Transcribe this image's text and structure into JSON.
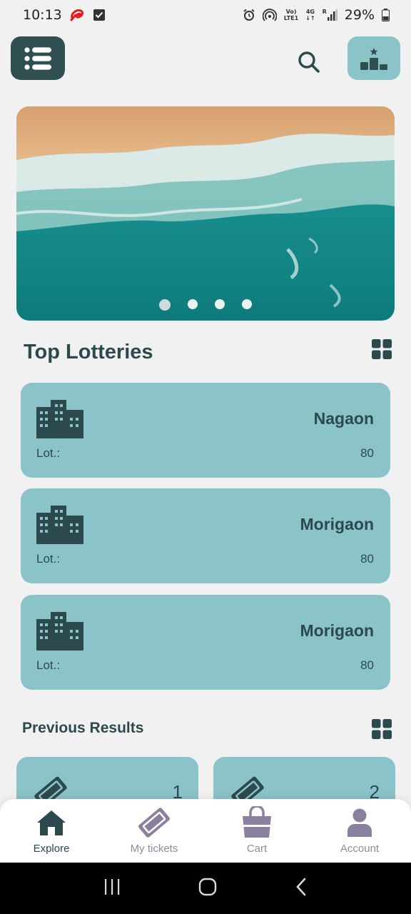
{
  "status_bar": {
    "time": "10:13",
    "battery": "29%",
    "volte_top": "Vo)",
    "volte_bottom": "LTE1",
    "net_top": "4G",
    "net_bottom": "↓↑",
    "signal_label": "R"
  },
  "toolbar": {
    "menu_icon": "list-icon",
    "search_icon": "search-icon",
    "leaderboard_icon": "podium-icon"
  },
  "banner": {
    "slide_count": 4,
    "active_slide": 1
  },
  "top_lotteries": {
    "title": "Top Lotteries",
    "items": [
      {
        "name": "Nagaon",
        "lot_label": "Lot.:",
        "lot_value": "80"
      },
      {
        "name": "Morigaon",
        "lot_label": "Lot.:",
        "lot_value": "80"
      },
      {
        "name": "Morigaon",
        "lot_label": "Lot.:",
        "lot_value": "80"
      }
    ]
  },
  "previous_results": {
    "title": "Previous Results",
    "items": [
      {
        "number": "1"
      },
      {
        "number": "2"
      }
    ]
  },
  "bottom_nav": {
    "items": [
      {
        "label": "Explore",
        "icon": "home-icon",
        "active": true
      },
      {
        "label": "My tickets",
        "icon": "ticket-icon",
        "active": false
      },
      {
        "label": "Cart",
        "icon": "shopping-bag-icon",
        "active": false
      },
      {
        "label": "Account",
        "icon": "person-icon",
        "active": false
      }
    ]
  },
  "colors": {
    "background": "#f1f1f1",
    "card": "#8ac3c8",
    "dark_teal": "#2f4f50",
    "text": "#2c4a4e",
    "inactive_icon": "#8a7f9e"
  }
}
